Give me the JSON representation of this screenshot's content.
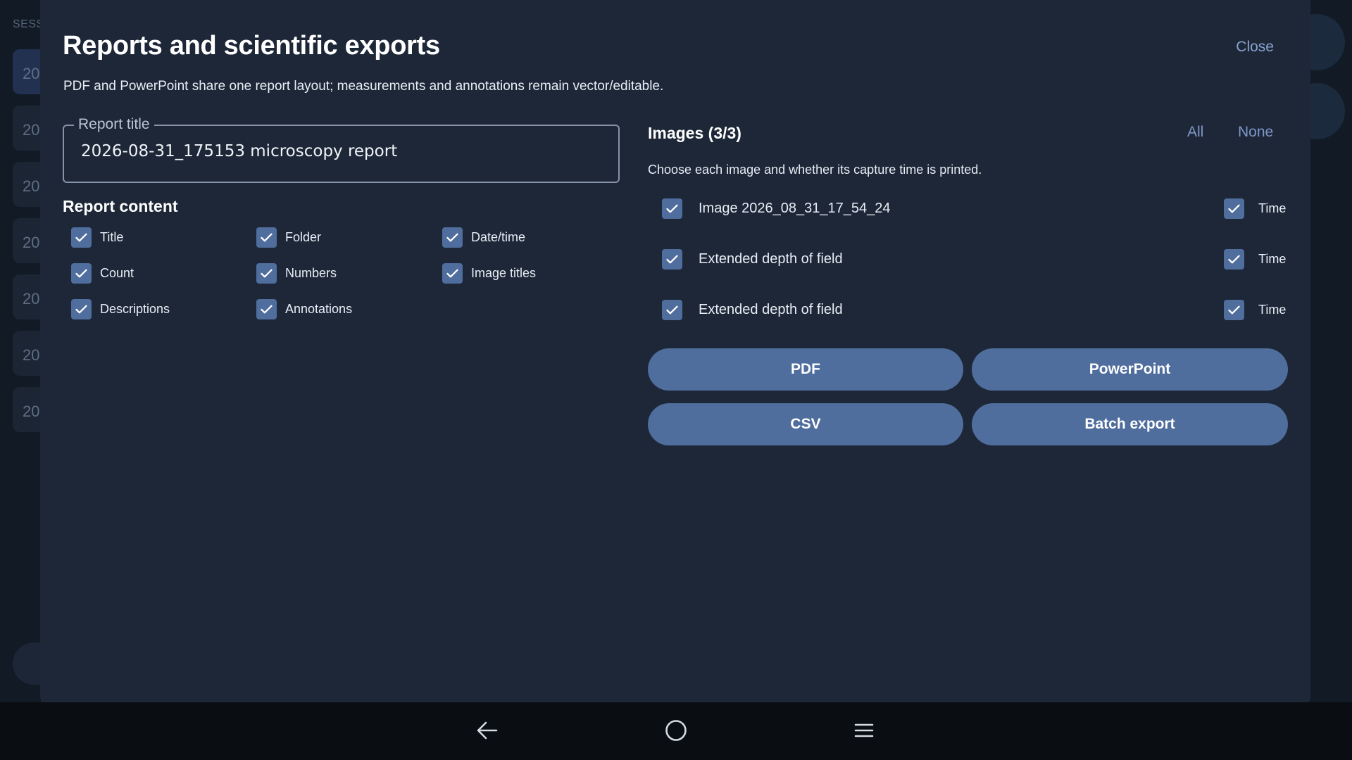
{
  "background": {
    "section_label": "SESSI",
    "rows": [
      "20",
      "20",
      "20",
      "20",
      "20",
      "20",
      "20"
    ]
  },
  "dialog": {
    "title": "Reports and scientific exports",
    "close_label": "Close",
    "subtitle": "PDF and PowerPoint share one report layout; measurements and annotations remain vector/editable.",
    "report_title": {
      "label": "Report title",
      "value": "2026-08-31_175153 microscopy report"
    },
    "report_content": {
      "heading": "Report content",
      "items": [
        {
          "label": "Title",
          "checked": true
        },
        {
          "label": "Folder",
          "checked": true
        },
        {
          "label": "Date/time",
          "checked": true
        },
        {
          "label": "Count",
          "checked": true
        },
        {
          "label": "Numbers",
          "checked": true
        },
        {
          "label": "Image titles",
          "checked": true
        },
        {
          "label": "Descriptions",
          "checked": true
        },
        {
          "label": "Annotations",
          "checked": true
        }
      ]
    },
    "images": {
      "heading": "Images (3/3)",
      "all_label": "All",
      "none_label": "None",
      "description": "Choose each image and whether its capture time is printed.",
      "time_label": "Time",
      "rows": [
        {
          "label": "Image 2026_08_31_17_54_24",
          "checked": true,
          "time_checked": true
        },
        {
          "label": "Extended depth of field",
          "checked": true,
          "time_checked": true
        },
        {
          "label": "Extended depth of field",
          "checked": true,
          "time_checked": true
        }
      ]
    },
    "actions": {
      "pdf": "PDF",
      "powerpoint": "PowerPoint",
      "csv": "CSV",
      "batch": "Batch export"
    }
  },
  "colors": {
    "accent": "#4f6d9d",
    "link": "#7d97c9",
    "dialog_bg": "#1d2737"
  },
  "navbar": {
    "icons": [
      "back-arrow-icon",
      "home-circle-icon",
      "menu-icon"
    ]
  }
}
